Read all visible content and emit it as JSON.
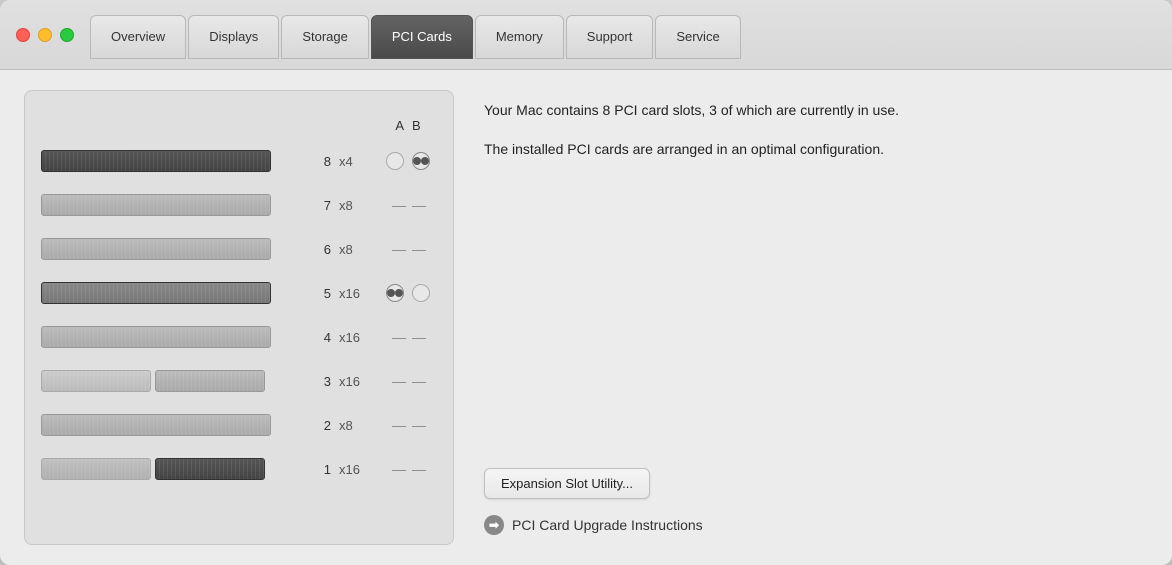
{
  "tabs": [
    {
      "id": "overview",
      "label": "Overview",
      "active": false
    },
    {
      "id": "displays",
      "label": "Displays",
      "active": false
    },
    {
      "id": "storage",
      "label": "Storage",
      "active": false
    },
    {
      "id": "pci-cards",
      "label": "PCI Cards",
      "active": true
    },
    {
      "id": "memory",
      "label": "Memory",
      "active": false
    },
    {
      "id": "support",
      "label": "Support",
      "active": false
    },
    {
      "id": "service",
      "label": "Service",
      "active": false
    }
  ],
  "col_a": "A",
  "col_b": "B",
  "slots": [
    {
      "num": "8",
      "speed": "x4",
      "hasCardA": false,
      "hasCardB": false,
      "cardAType": "dark-long",
      "radioA": false,
      "radioB": true,
      "dashA": false,
      "dashB": false
    },
    {
      "num": "7",
      "speed": "x8",
      "hasCard": true,
      "cardType": "medium",
      "dashA": true,
      "dashB": true
    },
    {
      "num": "6",
      "speed": "x8",
      "hasCard": true,
      "cardType": "medium",
      "dashA": true,
      "dashB": true
    },
    {
      "num": "5",
      "speed": "x16",
      "hasCard": true,
      "cardType": "dark-medium",
      "radioA": true,
      "radioB": false
    },
    {
      "num": "4",
      "speed": "x16",
      "hasCard": true,
      "cardType": "medium",
      "dashA": true,
      "dashB": true
    },
    {
      "num": "3",
      "speed": "x16",
      "hasCardLeft": true,
      "hasCardRight": true,
      "dashA": true,
      "dashB": true
    },
    {
      "num": "2",
      "speed": "x8",
      "hasCard": true,
      "cardType": "medium",
      "dashA": true,
      "dashB": true
    },
    {
      "num": "1",
      "speed": "x16",
      "hasCardLeft": true,
      "hasCardRight": true,
      "dashA": true,
      "dashB": true
    }
  ],
  "description1": "Your Mac contains 8 PCI card slots, 3 of which are currently in use.",
  "description2": "The installed PCI cards are arranged in an optimal configuration.",
  "expansion_btn": "Expansion Slot Utility...",
  "upgrade_link": "PCI Card Upgrade Instructions"
}
